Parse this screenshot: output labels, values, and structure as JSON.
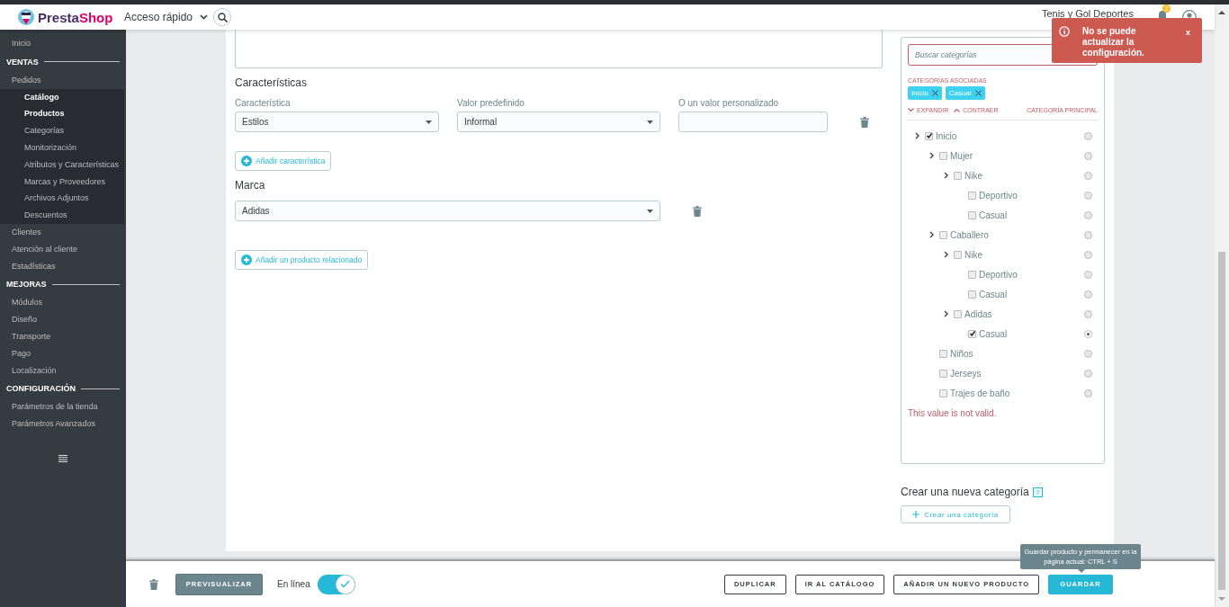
{
  "header": {
    "logo": {
      "first": "Presta",
      "second": "Shop"
    },
    "quick_access": "Acceso rápido",
    "shop_name": "Tenis y Gol Deportes",
    "notifications_count": "2"
  },
  "toast": {
    "message": "No se puede actualizar la configuración.",
    "close": "x"
  },
  "sidebar": {
    "groups": [
      {
        "items": [
          {
            "label": "Inicio",
            "selected": false
          }
        ]
      },
      {
        "heading": "VENTAS",
        "items": [
          {
            "label": "Pedidos",
            "selected": false
          },
          {
            "label": "Catálogo",
            "selected": true,
            "children": [
              {
                "label": "Productos",
                "selected": true
              },
              {
                "label": "Categorías",
                "selected": false
              },
              {
                "label": "Monitorización",
                "selected": false
              },
              {
                "label": "Atributos y Características",
                "selected": false
              },
              {
                "label": "Marcas y Proveedores",
                "selected": false
              },
              {
                "label": "Archivos Adjuntos",
                "selected": false
              },
              {
                "label": "Descuentos",
                "selected": false
              }
            ]
          },
          {
            "label": "Clientes",
            "selected": false
          },
          {
            "label": "Atención al cliente",
            "selected": false
          },
          {
            "label": "Estadísticas",
            "selected": false
          }
        ]
      },
      {
        "heading": "MEJORAS",
        "items": [
          {
            "label": "Módulos",
            "selected": false
          },
          {
            "label": "Diseño",
            "selected": false
          },
          {
            "label": "Transporte",
            "selected": false
          },
          {
            "label": "Pago",
            "selected": false
          },
          {
            "label": "Localización",
            "selected": false
          }
        ]
      },
      {
        "heading": "CONFIGURACIÓN",
        "items": [
          {
            "label": "Parámetros de la tienda",
            "selected": false
          },
          {
            "label": "Parámetros Avanzados",
            "selected": false
          }
        ]
      }
    ]
  },
  "features": {
    "title": "Características",
    "columns": [
      "Característica",
      "Valor predefinido",
      "O un valor personalizado"
    ],
    "rows": [
      {
        "feature": "Estilos",
        "value": "Informal"
      }
    ],
    "add_button": "Añadir característica"
  },
  "brand": {
    "title": "Marca",
    "value": "Adidas"
  },
  "related_button": "Añadir un producto relacionado",
  "categories": {
    "search_placeholder": "Buscar categorías",
    "associated_label": "CATEGORÍAS ASOCIADAS",
    "tags": [
      "Inicio",
      "Casual"
    ],
    "expand": "EXPANDIR",
    "collapse": "CONTRAER",
    "main_label": "CATEGORÍA PRINCIPAL",
    "tree": [
      {
        "label": "Inicio",
        "checked": true,
        "selected": false,
        "children": [
          {
            "label": "Mujer",
            "checked": false,
            "selected": false,
            "children": [
              {
                "label": "Nike",
                "checked": false,
                "selected": false,
                "children": [
                  {
                    "label": "Deportivo",
                    "checked": false,
                    "selected": false
                  },
                  {
                    "label": "Casual",
                    "checked": false,
                    "selected": false
                  }
                ]
              }
            ]
          },
          {
            "label": "Caballero",
            "checked": false,
            "selected": false,
            "children": [
              {
                "label": "Nike",
                "checked": false,
                "selected": false,
                "children": [
                  {
                    "label": "Deportivo",
                    "checked": false,
                    "selected": false
                  },
                  {
                    "label": "Casual",
                    "checked": false,
                    "selected": false
                  }
                ]
              },
              {
                "label": "Adidas",
                "checked": false,
                "selected": false,
                "children": [
                  {
                    "label": "Casual",
                    "checked": true,
                    "selected": true
                  }
                ]
              }
            ]
          },
          {
            "label": "Niños",
            "checked": false,
            "selected": false
          },
          {
            "label": "Jerseys",
            "checked": false,
            "selected": false
          },
          {
            "label": "Trajes de baño",
            "checked": false,
            "selected": false
          }
        ]
      }
    ],
    "error": "This value is not valid.",
    "new_title": "Crear una nueva categoría",
    "help": "?",
    "create_button": "Crear una categoría"
  },
  "footer": {
    "preview": "PREVISUALIZAR",
    "online_label": "En línea",
    "online": true,
    "buttons": [
      {
        "label": "DUPLICAR",
        "kind": "outline"
      },
      {
        "label": "IR AL CATÁLOGO",
        "kind": "outline"
      },
      {
        "label": "AÑADIR UN NUEVO PRODUCTO",
        "kind": "outline"
      },
      {
        "label": "GUARDAR",
        "kind": "primary"
      }
    ],
    "tooltip": "Guardar producto y permanecer en la página actual: CTRL + S"
  }
}
